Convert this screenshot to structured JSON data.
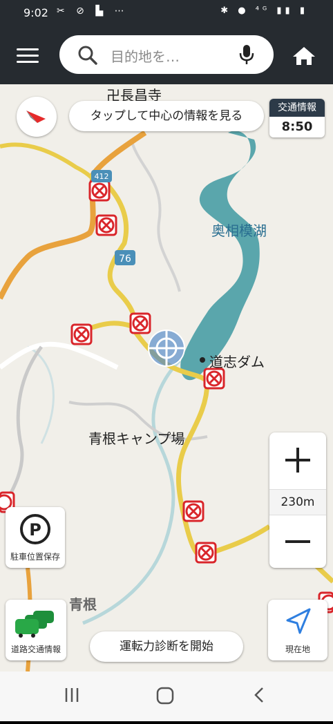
{
  "status_bar": {
    "time": "9:02",
    "left_icons": [
      "missed-call-icon",
      "sync-icon",
      "usb-icon",
      "more-dots-icon"
    ],
    "left_glyphs": "✂ ⊘ ▙ ⋯",
    "right_icons": [
      "bluetooth-icon",
      "location-icon",
      "network-4g-icon",
      "signal-icon",
      "battery-icon"
    ],
    "right_glyphs": "✱ ● ⁴ᴳ ▮▮ ▮"
  },
  "app_bar": {
    "search_placeholder": "目的地を…"
  },
  "map": {
    "center_info_button": "タップして中心の情報を見る",
    "traffic_info_label": "交通情報",
    "traffic_info_time": "8:50",
    "labels": {
      "temple": "卍長昌寺",
      "lake": "奥相模湖",
      "dam": "道志ダム",
      "campsite": "青根キャンプ場",
      "area": "青根"
    },
    "route_badges": [
      "412",
      "76"
    ],
    "zoom_scale": "230m",
    "parking_button": "駐車位置保存",
    "traffic_button": "道路交通情報",
    "current_location_button": "現在地",
    "driving_diagnosis_button": "運転力診断を開始"
  },
  "colors": {
    "appbar": "#262b30",
    "road_major": "#e8a23d",
    "road_secondary": "#e9cc4a",
    "water": "#5aa6ac",
    "map_bg": "#f1efe9",
    "incident_red": "#d9252a",
    "nav_blue": "#2f7fe0"
  }
}
